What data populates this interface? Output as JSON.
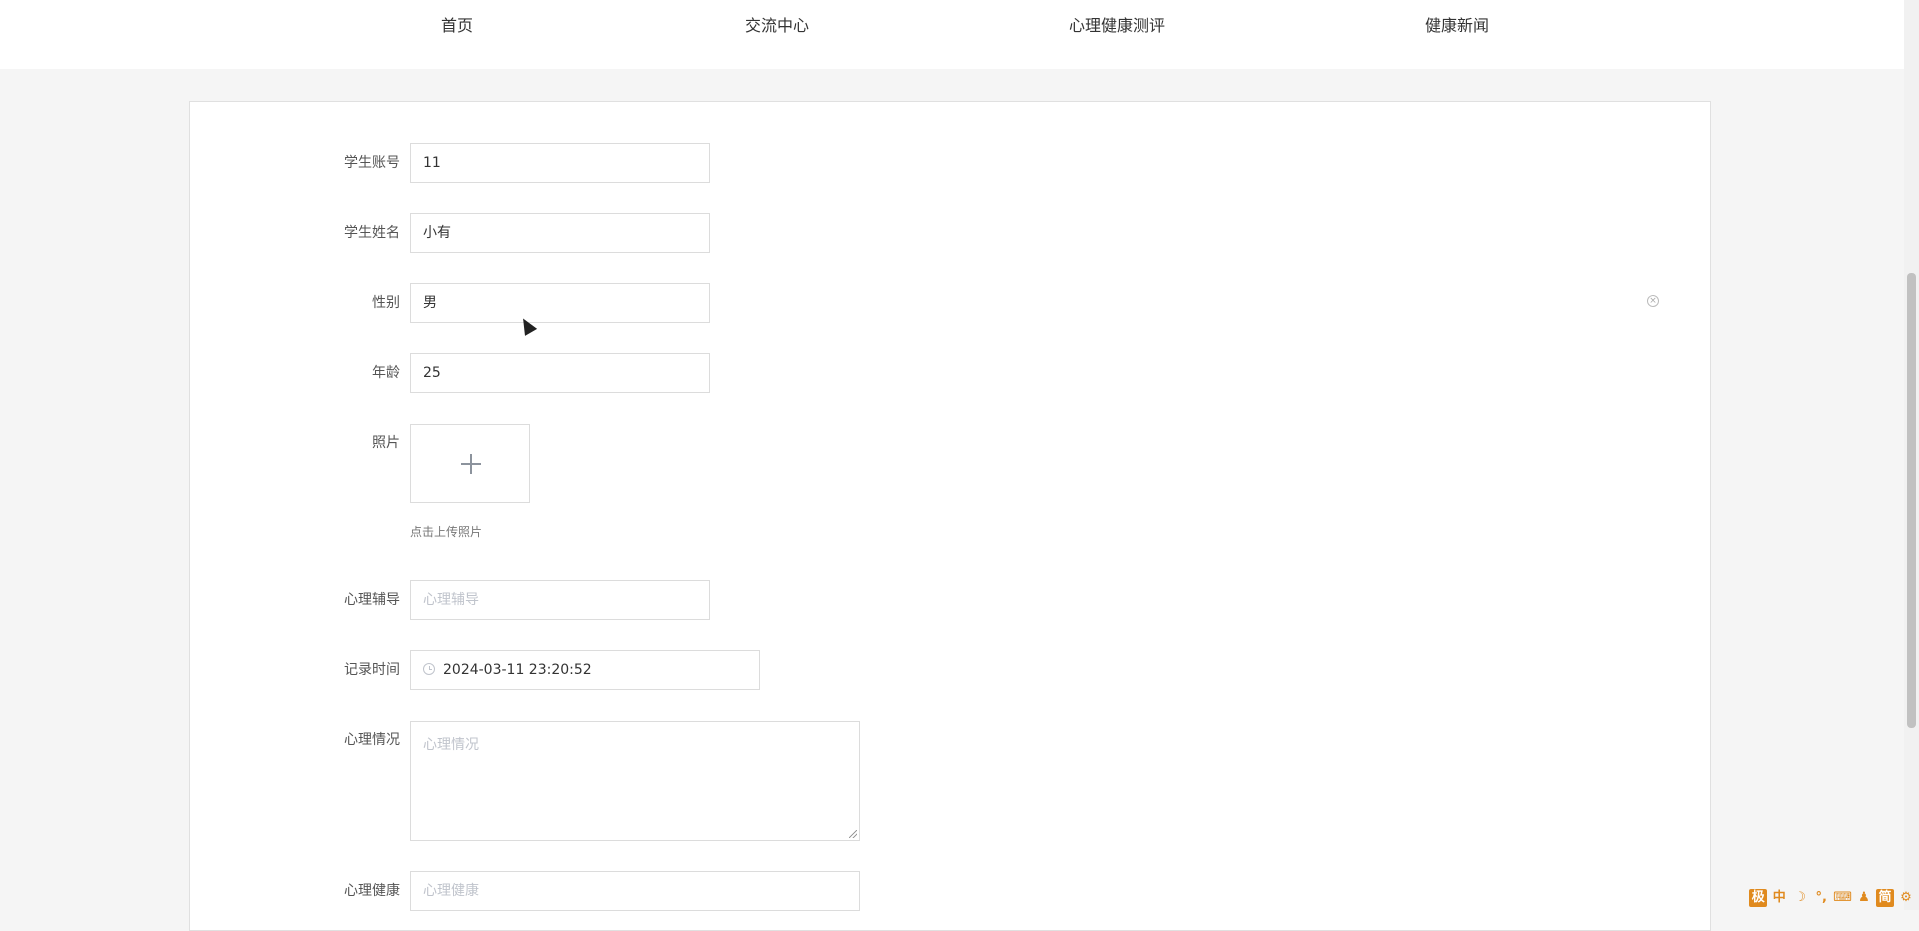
{
  "nav": {
    "items": [
      {
        "label": "首页"
      },
      {
        "label": "交流中心"
      },
      {
        "label": "心理健康测评"
      },
      {
        "label": "健康新闻"
      }
    ]
  },
  "form": {
    "account": {
      "label": "学生账号",
      "value": "11"
    },
    "name": {
      "label": "学生姓名",
      "value": "小有"
    },
    "gender": {
      "label": "性别",
      "value": "男"
    },
    "age": {
      "label": "年龄",
      "value": "25"
    },
    "photo": {
      "label": "照片",
      "hint": "点击上传照片"
    },
    "counseling": {
      "label": "心理辅导",
      "placeholder": "心理辅导"
    },
    "record_time": {
      "label": "记录时间",
      "value": "2024-03-11 23:20:52"
    },
    "situation": {
      "label": "心理情况",
      "placeholder": "心理情况"
    },
    "health": {
      "label": "心理健康",
      "placeholder": "心理健康"
    }
  },
  "ime_toolbar": {
    "items": [
      "极",
      "中",
      "☽",
      "°,",
      "⌨",
      "♟",
      "简",
      "⚙"
    ]
  },
  "colors": {
    "accent": "#e08a1e",
    "border": "#dcdcdc",
    "placeholder": "#c0c4cc"
  }
}
